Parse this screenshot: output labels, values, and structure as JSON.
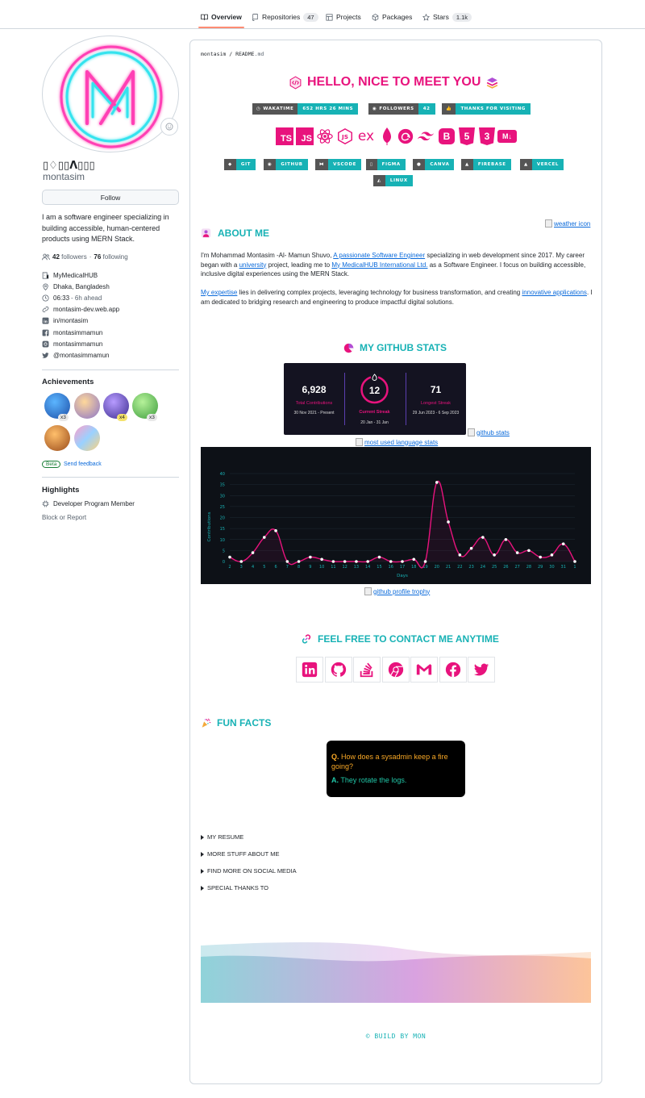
{
  "tabs": [
    {
      "label": "Overview"
    },
    {
      "label": "Repositories",
      "count": "47"
    },
    {
      "label": "Projects"
    },
    {
      "label": "Packages"
    },
    {
      "label": "Stars",
      "count": "1.1k"
    }
  ],
  "profile": {
    "name": "▯♢▯▯ᐱ▯▯▯",
    "login": "montasim",
    "follow_label": "Follow",
    "bio": "I am a software engineer specializing in building accessible, human-centered products using MERN Stack.",
    "followers_count": "42",
    "followers_label": "followers",
    "following_count": "76",
    "following_label": "following",
    "company": "MyMedicalHUB",
    "location": "Dhaka, Bangladesh",
    "time": "06:33",
    "time_note": "- 6h ahead",
    "website": "montasim-dev.web.app",
    "linkedin": "in/montasim",
    "facebook": "montasimmamun",
    "instagram": "montasimmamun",
    "twitter": "@montasimmamun"
  },
  "achievements": {
    "heading": "Achievements",
    "badges": [
      "x3",
      "x4",
      "x3"
    ],
    "beta": "Beta",
    "feedback": "Send feedback"
  },
  "highlights": {
    "heading": "Highlights",
    "item": "Developer Program Member",
    "block": "Block or Report"
  },
  "readme": {
    "crumb_user": "montasim",
    "crumb_file": "README",
    "crumb_ext": ".md",
    "hello": "HELLO, NICE TO MEET YOU",
    "stat_badges": [
      {
        "left": "WAKATIME",
        "right": "652 HRS 26 MINS"
      },
      {
        "left": "FOLLOWERS",
        "right": "42"
      },
      {
        "left": "👍",
        "right": "THANKS FOR VISITING"
      }
    ],
    "tech_icons": [
      "TS",
      "JS",
      "react-icon",
      "nodejs-icon",
      "express-icon",
      "mongodb-icon",
      "redux-icon",
      "tailwind-icon",
      "B",
      "5",
      "3",
      "M↓"
    ],
    "tool_badges": [
      {
        "left": "◆",
        "right": "GIT"
      },
      {
        "left": "◉",
        "right": "GITHUB"
      },
      {
        "left": "⧓",
        "right": "VSCODE"
      },
      {
        "left": "▯",
        "right": "FIGMA"
      },
      {
        "left": "●",
        "right": "CANVA"
      },
      {
        "left": "▲",
        "right": "FIREBASE"
      },
      {
        "left": "▲",
        "right": "VERCEL"
      },
      {
        "left": "◭",
        "right": "LINUX"
      }
    ],
    "weather_alt": "weather icon",
    "about_heading": "ABOUT ME",
    "about_p1_a": "I'm Mohammad Montasim -Al- Mamun Shuvo, ",
    "about_p1_link1": "A passionate Software Engineer",
    "about_p1_b": " specializing in web development since 2017. My career began with a ",
    "about_p1_link2": "university",
    "about_p1_c": " project, leading me to ",
    "about_p1_link3": "My MedicalHUB International Ltd.",
    "about_p1_d": " as a Software Engineer. I focus on building accessible, inclusive digital experiences using the MERN Stack.",
    "about_p2_link1": "My expertise",
    "about_p2_a": " lies in delivering complex projects, leveraging technology for business transformation, and creating ",
    "about_p2_link2": "innovative applications",
    "about_p2_b": ". I am dedicated to bridging research and engineering to produce impactful digital solutions.",
    "stats_heading": "MY GITHUB STATS",
    "streak": {
      "total": "6,928",
      "total_label": "Total Contributions",
      "total_range": "30 Nov 2021 - Present",
      "current": "12",
      "current_label": "Current Streak",
      "current_range": "20 Jan - 31 Jan",
      "longest": "71",
      "longest_label": "Longest Streak",
      "longest_range": "29 Jun 2023 - 6 Sep 2023"
    },
    "github_stats_alt": "github stats",
    "most_used_alt": "most used language stats",
    "trophy_alt": "github profile trophy",
    "contact_heading": "FEEL FREE TO CONTACT ME ANYTIME",
    "social_icons": [
      "linkedin-icon",
      "github-icon",
      "stackoverflow-icon",
      "chrome-icon",
      "gmail-icon",
      "facebook-icon",
      "twitter-icon"
    ],
    "fun_heading": "FUN FACTS",
    "joke_q_label": "Q.",
    "joke_q": " How does a sysadmin keep a fire going?",
    "joke_a_label": "A.",
    "joke_a": " They rotate the logs.",
    "details": [
      "MY RESUME",
      "MORE STUFF ABOUT ME",
      "FIND MORE ON SOCIAL MEDIA",
      "SPECIAL THANKS TO"
    ],
    "footer": "© BUILD BY MON"
  },
  "colors": {
    "accent_pink": "#e8137d",
    "accent_teal": "#18b2b5",
    "tab_underline": "#fd8c73"
  },
  "chart_data": {
    "type": "line",
    "title": "",
    "xlabel": "Days",
    "ylabel": "Contributions",
    "x": [
      "2",
      "3",
      "4",
      "5",
      "6",
      "7",
      "8",
      "9",
      "10",
      "11",
      "12",
      "13",
      "14",
      "15",
      "16",
      "17",
      "18",
      "19",
      "20",
      "21",
      "22",
      "23",
      "24",
      "25",
      "26",
      "27",
      "28",
      "29",
      "30",
      "31",
      "1"
    ],
    "values": [
      2,
      0,
      4,
      11,
      14,
      0,
      0,
      2,
      1,
      0,
      0,
      0,
      0,
      2,
      0,
      0,
      1,
      0,
      36,
      18,
      3,
      6,
      11,
      3,
      10,
      4,
      5,
      2,
      3,
      8,
      0
    ],
    "yticks": [
      0,
      5,
      10,
      15,
      20,
      25,
      30,
      35,
      40
    ],
    "ylim": [
      0,
      40
    ],
    "grid": true
  }
}
